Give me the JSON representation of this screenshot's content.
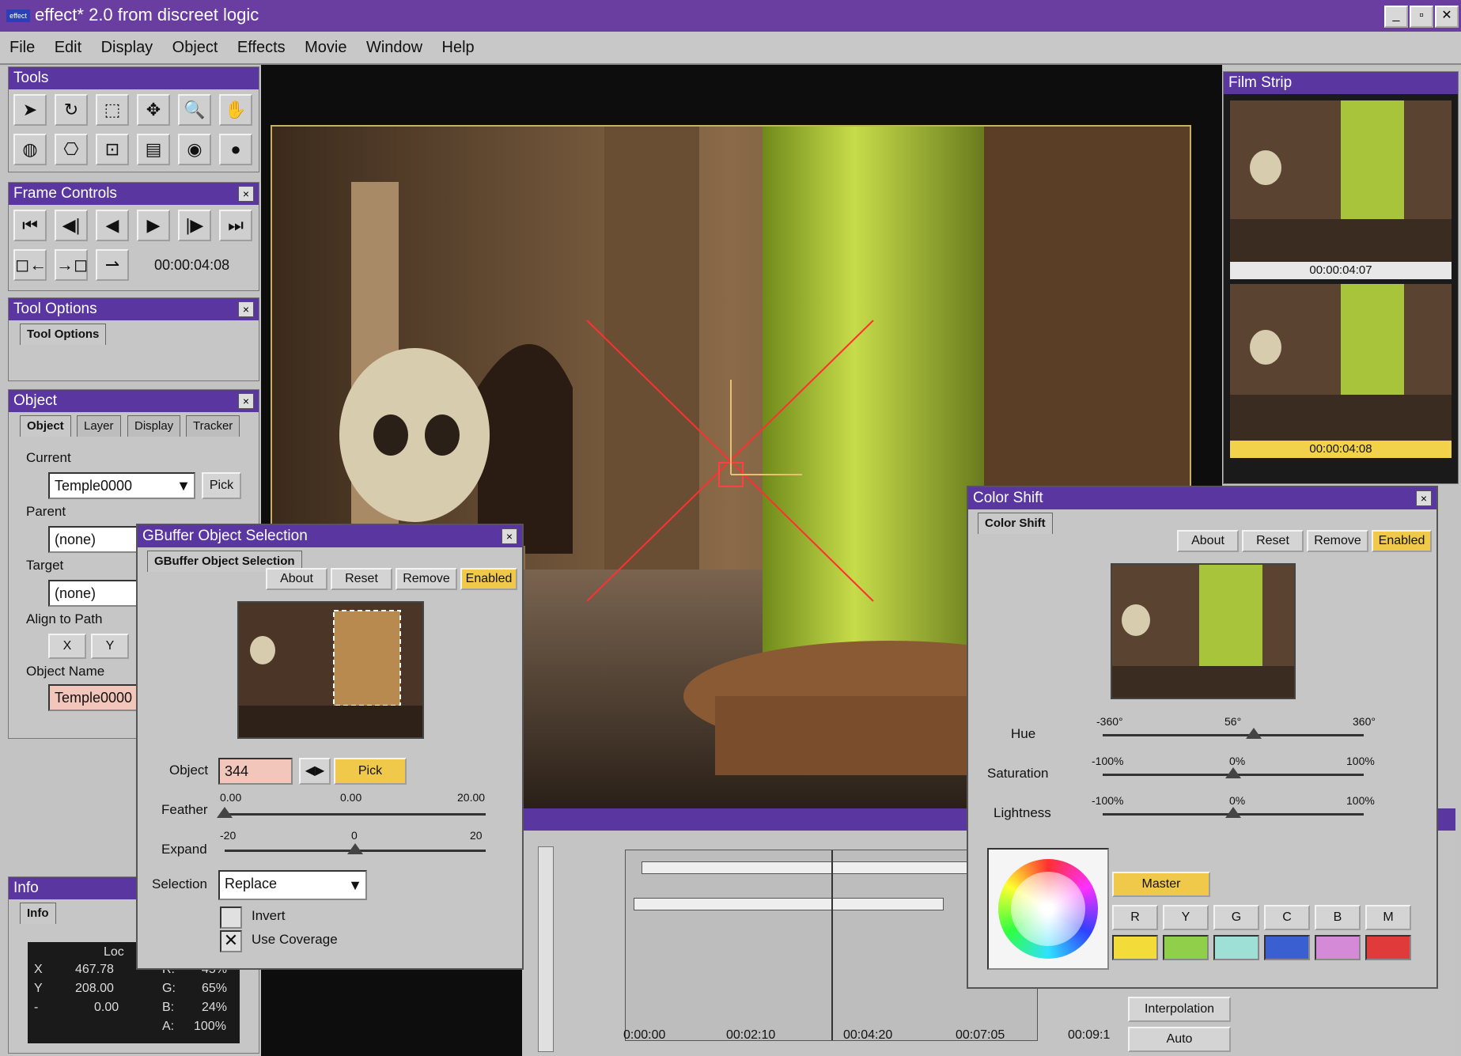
{
  "app": {
    "title": "effect* 2.0 from discreet logic",
    "logo_text": "effect",
    "window_buttons": [
      "_",
      "▫",
      "✕"
    ]
  },
  "menu": [
    "File",
    "Edit",
    "Display",
    "Object",
    "Effects",
    "Movie",
    "Window",
    "Help"
  ],
  "tools_panel": {
    "title": "Tools"
  },
  "frame_controls": {
    "title": "Frame Controls",
    "timecode": "00:00:04:08"
  },
  "tool_options": {
    "title": "Tool Options",
    "tab": "Tool Options"
  },
  "object_panel": {
    "title": "Object",
    "tabs": [
      "Object",
      "Layer",
      "Display",
      "Tracker"
    ],
    "current_label": "Current",
    "current_value": "Temple0000",
    "pick_label": "Pick",
    "parent_label": "Parent",
    "parent_value": "(none)",
    "target_label": "Target",
    "target_value": "(none)",
    "align_label": "Align to Path",
    "align_x": "X",
    "align_y": "Y",
    "object_name_label": "Object Name",
    "object_name_value": "Temple0000"
  },
  "info_panel": {
    "title": "Info",
    "tab": "Info",
    "loc_label": "Loc",
    "x_label": "X",
    "x_value": "467.78",
    "y_label": "Y",
    "y_value": "208.00",
    "z_label": "-",
    "z_value": "0.00",
    "r_label": "R:",
    "r_value": "45%",
    "g_label": "G:",
    "g_value": "65%",
    "b_label": "B:",
    "b_value": "24%",
    "a_label": "A:",
    "a_value": "100%"
  },
  "gbuffer": {
    "title": "GBuffer Object Selection",
    "tab": "GBuffer Object Selection",
    "buttons": [
      "About",
      "Reset",
      "Remove",
      "Enabled"
    ],
    "object_label": "Object",
    "object_value": "344",
    "pick_label": "Pick",
    "feather_label": "Feather",
    "feather_min": "0.00",
    "feather_mid": "0.00",
    "feather_max": "20.00",
    "feather_value": 0,
    "expand_label": "Expand",
    "expand_min": "-20",
    "expand_mid": "0",
    "expand_max": "20",
    "expand_value": 0,
    "selection_label": "Selection",
    "selection_value": "Replace",
    "invert_label": "Invert",
    "use_coverage_label": "Use Coverage"
  },
  "film_strip": {
    "title": "Film Strip",
    "frames": [
      "00:00:04:07",
      "00:00:04:08"
    ]
  },
  "color_shift": {
    "title": "Color Shift",
    "tab": "Color Shift",
    "buttons": [
      "About",
      "Reset",
      "Remove",
      "Enabled"
    ],
    "hue_label": "Hue",
    "hue_min": "-360°",
    "hue_val": "56°",
    "hue_max": "360°",
    "hue_value": 56,
    "sat_label": "Saturation",
    "sat_min": "-100%",
    "sat_val": "0%",
    "sat_max": "100%",
    "sat_value": 0,
    "light_label": "Lightness",
    "light_min": "-100%",
    "light_val": "0%",
    "light_max": "100%",
    "light_value": 0,
    "master_label": "Master",
    "channels": [
      "R",
      "Y",
      "G",
      "C",
      "B",
      "M"
    ],
    "channel_colors": [
      "#f3dc3a",
      "#8fcf4a",
      "#9fe0d6",
      "#3a5fd0",
      "#d58ad8",
      "#e03a3a"
    ]
  },
  "timeline": {
    "ticks": [
      "0:00:00",
      "00:02:10",
      "00:04:20",
      "00:07:05",
      "00:09:1"
    ],
    "side_buttons": [
      "Interpolation",
      "Auto"
    ]
  }
}
